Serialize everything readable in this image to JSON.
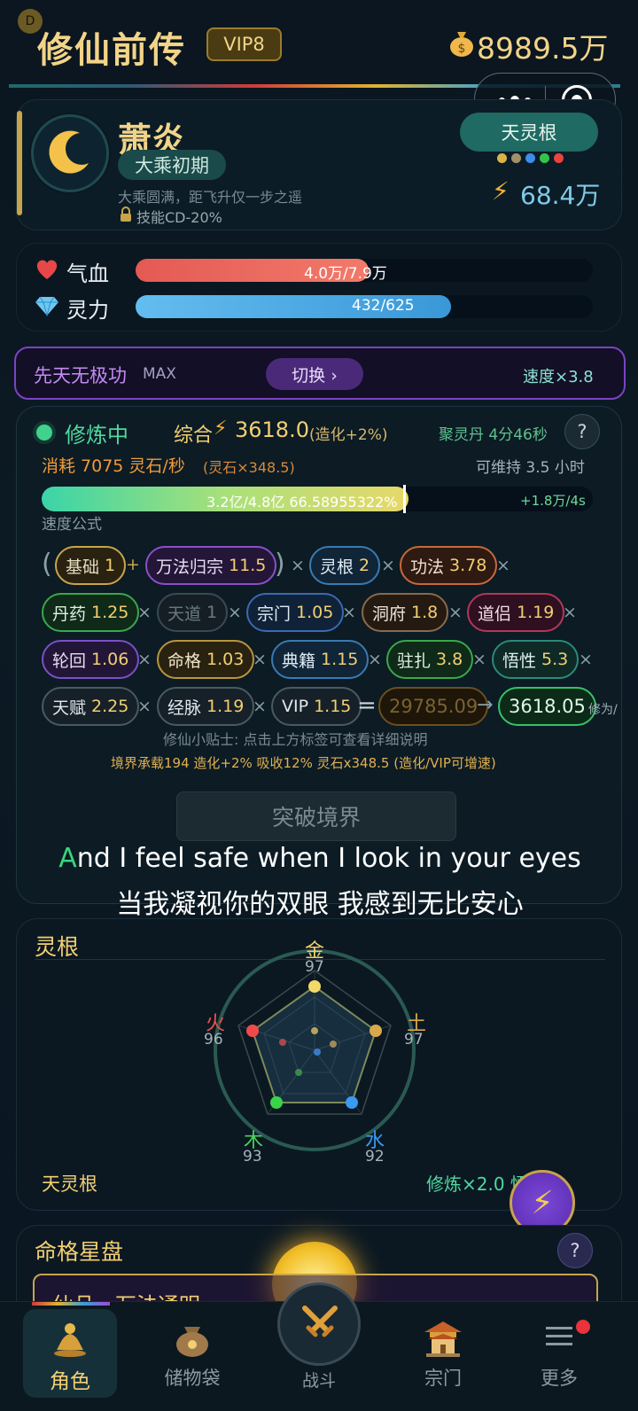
{
  "header": {
    "dot_badge": "D",
    "title": "修仙前传",
    "vip": "VIP8",
    "currency": "8989.5万"
  },
  "profile": {
    "name": "萧炎",
    "realm": "大乘初期",
    "description": "大乘圆满，距飞升仅一步之遥",
    "skill_cd": "技能CD-20%",
    "root_tag": "天灵根",
    "power": "68.4万"
  },
  "stats": {
    "hp_label": "气血",
    "hp_text": "4.0万/7.9万",
    "hp_fraction": 0.51,
    "mp_label": "灵力",
    "mp_text": "432/625",
    "mp_fraction": 0.69
  },
  "technique": {
    "name": "先天无极功",
    "level": "MAX",
    "switch_label": "切换 ›",
    "speed": "速度×3.8"
  },
  "cultivation": {
    "status": "修炼中",
    "composite_label": "综合",
    "composite_value": "3618.0",
    "composite_bonus": "(造化+2%)",
    "pill_timer": "聚灵丹 4分46秒",
    "help": "?",
    "consume": "消耗 7075 灵石/秒",
    "consume_rate": "(灵石×348.5)",
    "sustain": "可维持 3.5 小时",
    "progress_text": "3.2亿/4.8亿  66.58955322%",
    "progress_fraction": 0.6659,
    "progress_gain": "+1.8万/4s",
    "formula_label": "速度公式",
    "tip": "修仙小贴士: 点击上方标签可查看详细说明",
    "summary": "境界承载194 造化+2% 吸收12% 灵石x348.5 (造化/VIP可增速)",
    "breakthrough": "突破境界"
  },
  "formula": {
    "ops": {
      "plus": "+",
      "times": "×",
      "equals": "=",
      "arrow": "→"
    },
    "row1": [
      {
        "label": "基础",
        "value": "1"
      },
      {
        "label": "万法归宗",
        "value": "11.5"
      },
      {
        "label": "灵根",
        "value": "2"
      },
      {
        "label": "功法",
        "value": "3.78"
      }
    ],
    "row2": [
      {
        "label": "丹药",
        "value": "1.25"
      },
      {
        "label": "天道",
        "value": "1"
      },
      {
        "label": "宗门",
        "value": "1.05"
      },
      {
        "label": "洞府",
        "value": "1.8"
      },
      {
        "label": "道侣",
        "value": "1.19"
      }
    ],
    "row3": [
      {
        "label": "轮回",
        "value": "1.06"
      },
      {
        "label": "命格",
        "value": "1.03"
      },
      {
        "label": "典籍",
        "value": "1.15"
      },
      {
        "label": "驻扎",
        "value": "3.8"
      },
      {
        "label": "悟性",
        "value": "5.3"
      }
    ],
    "row4": [
      {
        "label": "天赋",
        "value": "2.25"
      },
      {
        "label": "经脉",
        "value": "1.19"
      },
      {
        "label": "VIP",
        "value": "1.15"
      }
    ],
    "raw_result": "29785.09",
    "final_result": "3618.05",
    "unit": "修为/"
  },
  "lyrics": {
    "english_first": "A",
    "english_rest": "nd I feel safe when I look in your eyes",
    "chinese": "当我凝视你的双眼 我感到无比安心"
  },
  "spirit_root": {
    "title": "灵根",
    "metal": {
      "label": "金",
      "value": "97"
    },
    "earth": {
      "label": "土",
      "value": "97"
    },
    "water": {
      "label": "水",
      "value": "92"
    },
    "wood": {
      "label": "木",
      "value": "93"
    },
    "fire": {
      "label": "火",
      "value": "96"
    },
    "type": "天灵根",
    "multiplier": "修炼×2.0   悟 10"
  },
  "destiny": {
    "title": "命格星盘",
    "help": "?",
    "banner": "仙品 · 万法通明"
  },
  "nav": [
    "角色",
    "储物袋",
    "战斗",
    "宗门",
    "更多"
  ],
  "colors": {
    "gold": "#f2cf72",
    "accent_green": "#4fd9a0",
    "purple": "#7b43c4",
    "background": "#0a1620"
  }
}
